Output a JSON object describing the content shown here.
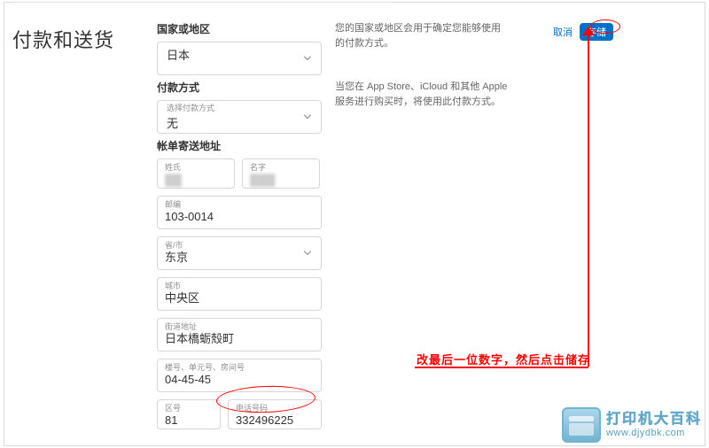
{
  "page_title": "付款和送货",
  "country": {
    "label": "国家或地区",
    "value": "日本",
    "help": "您的国家或地区会用于确定您能够使用的付款方式。"
  },
  "payment": {
    "label": "付款方式",
    "inner_label": "选择付款方式",
    "value": "无",
    "help": "当您在 App Store、iCloud 和其他 Apple 服务进行购买时，将使用此付款方式。"
  },
  "billing": {
    "label": "帐单寄送地址",
    "last_name_label": "姓氏",
    "last_name_value": "▓▓",
    "first_name_label": "名字",
    "first_name_value": "▓▓▓",
    "postal_label": "邮编",
    "postal_value": "103-0014",
    "prefecture_label": "省/市",
    "prefecture_value": "东京",
    "city_label": "城市",
    "city_value": "中央区",
    "street_label": "街道地址",
    "street_value": "日本橋蛎殼町",
    "unit_label": "楼号、单元号、房间号",
    "unit_value": "04-45-45",
    "area_code_label": "区号",
    "area_code_value": "81",
    "phone_label": "电话号码",
    "phone_value": "332496225"
  },
  "actions": {
    "cancel": "取消",
    "save": "存储"
  },
  "annotation": {
    "text": "改最后一位数字，然后点击储存"
  },
  "watermark": {
    "title": "打印机大百科",
    "url": "www.djydbk.com"
  }
}
